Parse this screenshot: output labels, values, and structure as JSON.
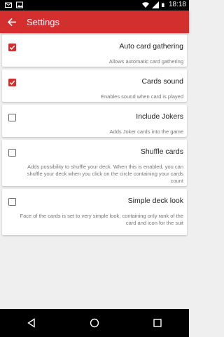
{
  "status_bar": {
    "time": "18:18",
    "left_icons": [
      "mail-icon",
      "image-icon"
    ],
    "right_icons": [
      "wifi-icon",
      "signal-icon",
      "battery-icon"
    ]
  },
  "app_bar": {
    "title": "Settings",
    "back_icon": "arrow-back-icon",
    "color": "#d32f2f"
  },
  "settings": [
    {
      "id": "auto-card-gathering",
      "title": "Auto card gathering",
      "description": "Allows automatic card gathering",
      "checked": true
    },
    {
      "id": "cards-sound",
      "title": "Cards sound",
      "description": "Enables sound when card is played",
      "checked": true
    },
    {
      "id": "include-jokers",
      "title": "Include Jokers",
      "description": "Adds Joker cards into the game",
      "checked": false
    },
    {
      "id": "shuffle-cards",
      "title": "Shuffle cards",
      "description": "Adds possibility to shuffle your deck. When this is enabled, you can shuffle your deck when you click on the circle containing your cards count",
      "checked": false
    },
    {
      "id": "simple-deck-look",
      "title": "Simple deck look",
      "description": "Face of the cards is set to very simple look, containing only rank of the card and icon for the suit",
      "checked": false
    }
  ],
  "nav_bar": {
    "icons": [
      "nav-back-icon",
      "nav-home-icon",
      "nav-recents-icon"
    ]
  }
}
